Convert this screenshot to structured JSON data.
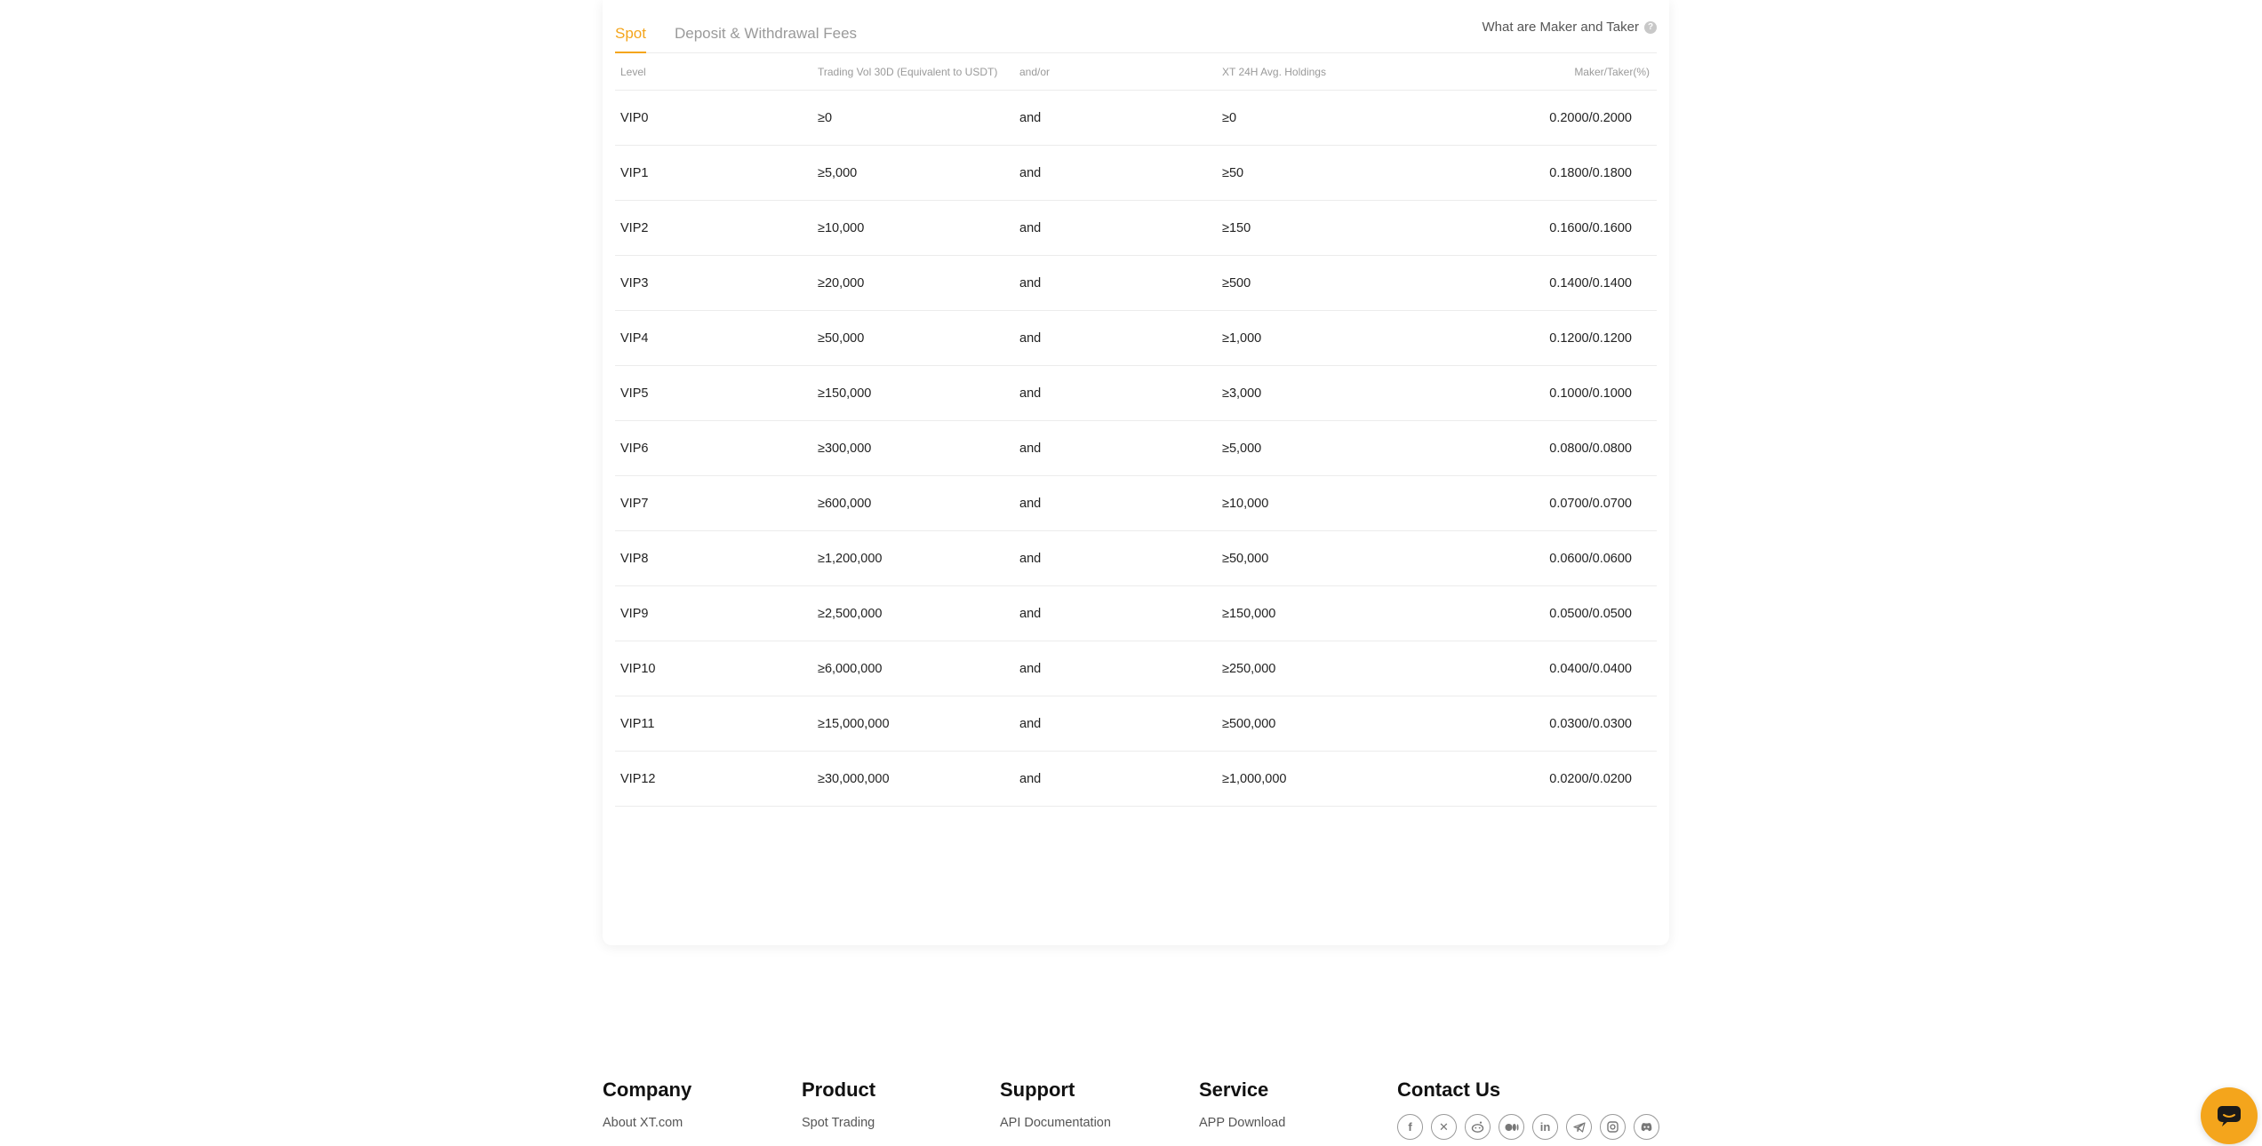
{
  "tabs": {
    "spot": "Spot",
    "fees": "Deposit & Withdrawal Fees",
    "maker_taker_link": "What are Maker and Taker"
  },
  "table": {
    "headers": {
      "level": "Level",
      "volume": "Trading Vol 30D (Equivalent to USDT)",
      "andor": "and/or",
      "holdings": "XT 24H Avg. Holdings",
      "rate": "Maker/Taker(%)"
    },
    "rows": [
      {
        "level": "VIP0",
        "volume": "≥0",
        "andor": "and",
        "holdings": "≥0",
        "rate": "0.2000/0.2000"
      },
      {
        "level": "VIP1",
        "volume": "≥5,000",
        "andor": "and",
        "holdings": "≥50",
        "rate": "0.1800/0.1800"
      },
      {
        "level": "VIP2",
        "volume": "≥10,000",
        "andor": "and",
        "holdings": "≥150",
        "rate": "0.1600/0.1600"
      },
      {
        "level": "VIP3",
        "volume": "≥20,000",
        "andor": "and",
        "holdings": "≥500",
        "rate": "0.1400/0.1400"
      },
      {
        "level": "VIP4",
        "volume": "≥50,000",
        "andor": "and",
        "holdings": "≥1,000",
        "rate": "0.1200/0.1200"
      },
      {
        "level": "VIP5",
        "volume": "≥150,000",
        "andor": "and",
        "holdings": "≥3,000",
        "rate": "0.1000/0.1000"
      },
      {
        "level": "VIP6",
        "volume": "≥300,000",
        "andor": "and",
        "holdings": "≥5,000",
        "rate": "0.0800/0.0800"
      },
      {
        "level": "VIP7",
        "volume": "≥600,000",
        "andor": "and",
        "holdings": "≥10,000",
        "rate": "0.0700/0.0700"
      },
      {
        "level": "VIP8",
        "volume": "≥1,200,000",
        "andor": "and",
        "holdings": "≥50,000",
        "rate": "0.0600/0.0600"
      },
      {
        "level": "VIP9",
        "volume": "≥2,500,000",
        "andor": "and",
        "holdings": "≥150,000",
        "rate": "0.0500/0.0500"
      },
      {
        "level": "VIP10",
        "volume": "≥6,000,000",
        "andor": "and",
        "holdings": "≥250,000",
        "rate": "0.0400/0.0400"
      },
      {
        "level": "VIP11",
        "volume": "≥15,000,000",
        "andor": "and",
        "holdings": "≥500,000",
        "rate": "0.0300/0.0300"
      },
      {
        "level": "VIP12",
        "volume": "≥30,000,000",
        "andor": "and",
        "holdings": "≥1,000,000",
        "rate": "0.0200/0.0200"
      }
    ]
  },
  "footer": {
    "company": {
      "title": "Company",
      "link": "About XT.com"
    },
    "product": {
      "title": "Product",
      "link": "Spot Trading"
    },
    "support": {
      "title": "Support",
      "link": "API Documentation"
    },
    "service": {
      "title": "Service",
      "link": "APP Download"
    },
    "contact": {
      "title": "Contact Us"
    }
  },
  "social_icons": [
    "facebook-icon",
    "x-icon",
    "reddit-icon",
    "medium-icon",
    "linkedin-icon",
    "telegram-icon",
    "instagram-icon",
    "discord-icon"
  ],
  "colors": {
    "accent": "#f4a51c"
  }
}
